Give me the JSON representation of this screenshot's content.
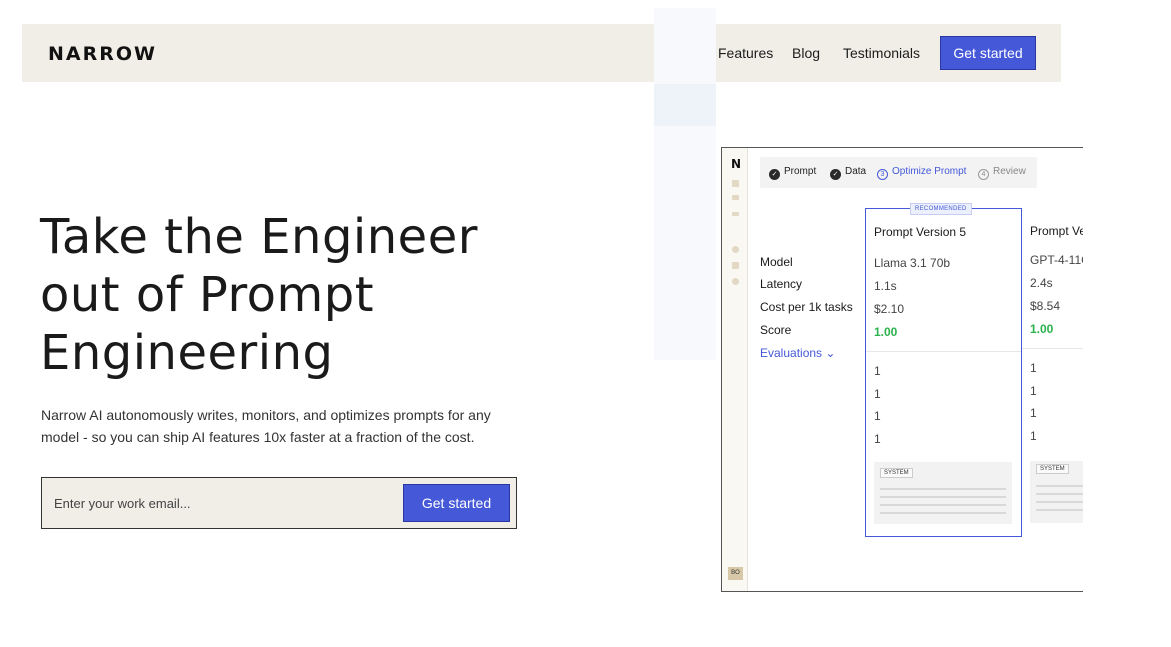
{
  "nav": {
    "logo": "NARROW",
    "links": [
      "Features",
      "Blog",
      "Testimonials"
    ],
    "cta": "Get started"
  },
  "hero": {
    "title_lines": [
      "Take the Engineer",
      "out of Prompt",
      "Engineering"
    ],
    "subtitle": "Narrow AI autonomously writes, monitors, and optimizes prompts for any model - so you can ship AI features 10x faster at a fraction of the cost.",
    "email_placeholder": "Enter your work email...",
    "cta": "Get started"
  },
  "preview": {
    "rail_logo": "N",
    "avatar": "BO",
    "steps": [
      {
        "label": "Prompt",
        "state": "done",
        "marker": "✓"
      },
      {
        "label": "Data",
        "state": "done",
        "marker": "✓"
      },
      {
        "label": "Optimize Prompt",
        "state": "active",
        "marker": "3"
      },
      {
        "label": "Review",
        "state": "todo",
        "marker": "4"
      }
    ],
    "row_labels": [
      "Model",
      "Latency",
      "Cost per 1k tasks",
      "Score"
    ],
    "evaluations_label": "Evaluations ⌄",
    "cards": [
      {
        "badge": "RECOMMENDED",
        "title": "Prompt Version 5",
        "model": "Llama 3.1 70b",
        "latency": "1.1s",
        "cost": "$2.10",
        "score": "1.00",
        "evals": [
          "1",
          "1",
          "1",
          "1"
        ],
        "system_tag": "SYSTEM"
      },
      {
        "title": "Prompt Ve",
        "model": "GPT-4-11C",
        "latency": "2.4s",
        "cost": "$8.54",
        "score": "1.00",
        "evals": [
          "1",
          "1",
          "1",
          "1"
        ],
        "system_tag": "SYSTEM"
      }
    ]
  },
  "colors": {
    "nav_bg": "#f1eee8",
    "accent": "#4458d8",
    "score_green": "#2bb24c"
  }
}
